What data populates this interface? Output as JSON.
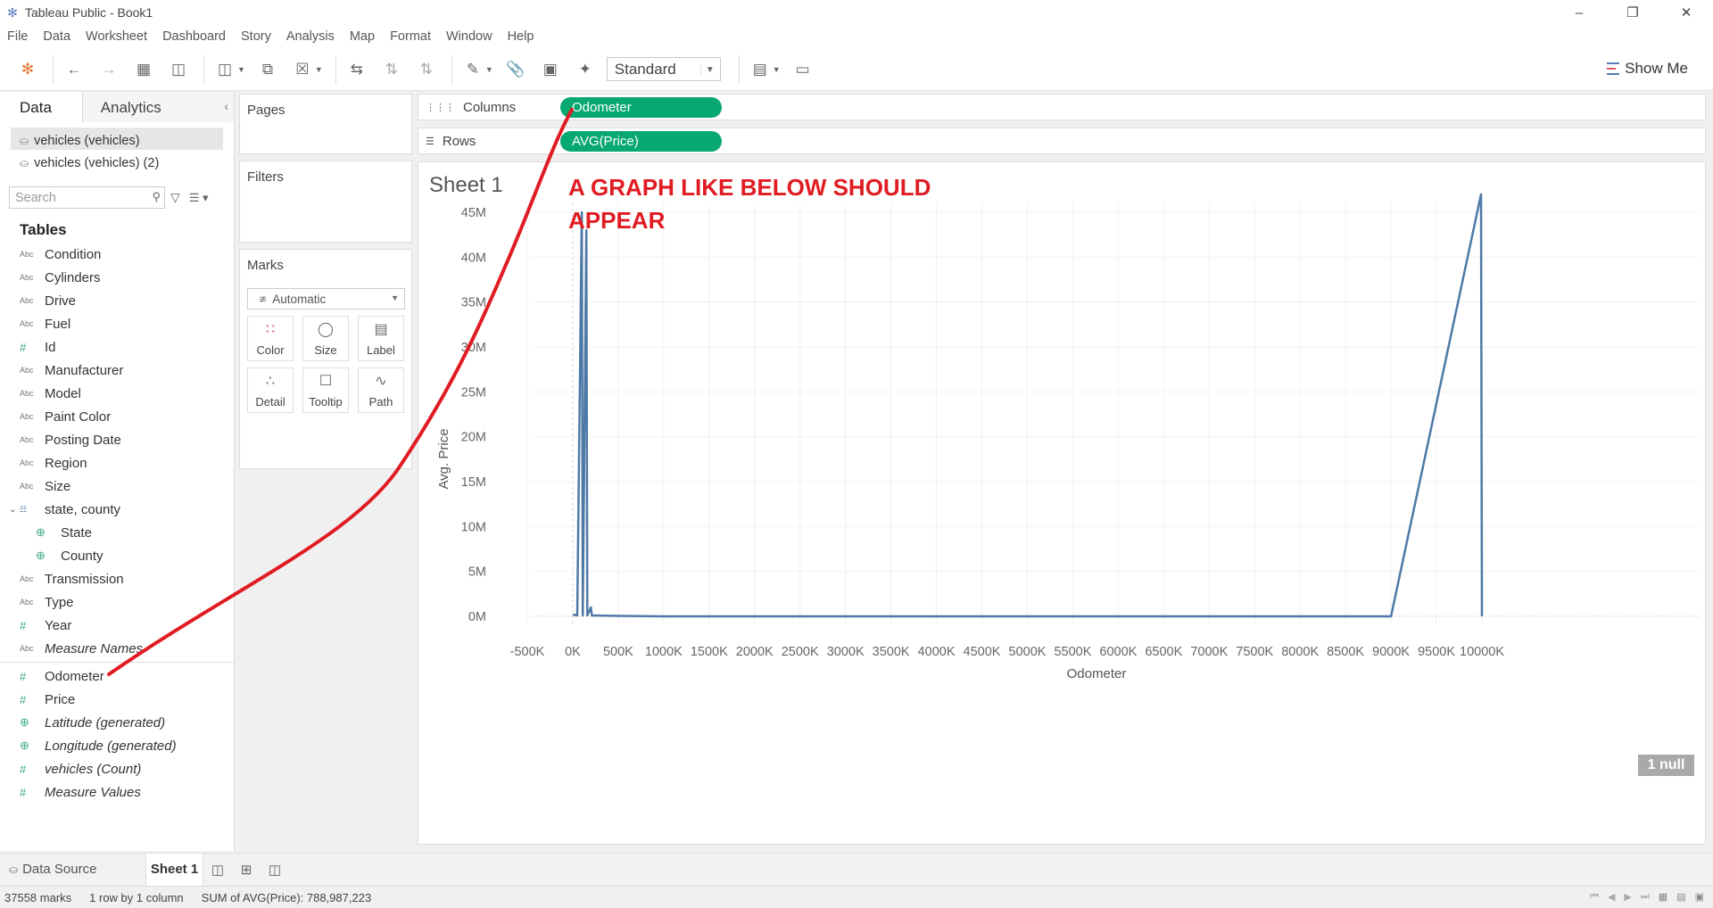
{
  "window": {
    "title": "Tableau Public - Book1"
  },
  "menu": [
    "File",
    "Data",
    "Worksheet",
    "Dashboard",
    "Story",
    "Analysis",
    "Map",
    "Format",
    "Window",
    "Help"
  ],
  "toolbar": {
    "fit": "Standard",
    "show_me": "Show Me"
  },
  "data_pane": {
    "tabs": {
      "data": "Data",
      "analytics": "Analytics"
    },
    "sources": [
      "vehicles (vehicles)",
      "vehicles (vehicles) (2)"
    ],
    "search_placeholder": "Search",
    "tables_heading": "Tables",
    "fields": [
      {
        "type": "Abc",
        "name": "Condition"
      },
      {
        "type": "Abc",
        "name": "Cylinders"
      },
      {
        "type": "Abc",
        "name": "Drive"
      },
      {
        "type": "Abc",
        "name": "Fuel"
      },
      {
        "type": "#",
        "name": "Id"
      },
      {
        "type": "Abc",
        "name": "Manufacturer"
      },
      {
        "type": "Abc",
        "name": "Model"
      },
      {
        "type": "Abc",
        "name": "Paint Color"
      },
      {
        "type": "Abc",
        "name": "Posting Date"
      },
      {
        "type": "Abc",
        "name": "Region"
      },
      {
        "type": "Abc",
        "name": "Size"
      },
      {
        "type": "hier",
        "name": "state, county"
      },
      {
        "type": "geo",
        "name": "State",
        "sub": true
      },
      {
        "type": "geo",
        "name": "County",
        "sub": true
      },
      {
        "type": "Abc",
        "name": "Transmission"
      },
      {
        "type": "Abc",
        "name": "Type"
      },
      {
        "type": "#",
        "name": "Year"
      },
      {
        "type": "Abc",
        "name": "Measure Names",
        "italic": true
      }
    ],
    "measures": [
      {
        "type": "#",
        "name": "Odometer"
      },
      {
        "type": "#",
        "name": "Price"
      },
      {
        "type": "geo",
        "name": "Latitude (generated)",
        "italic": true
      },
      {
        "type": "geo",
        "name": "Longitude (generated)",
        "italic": true
      },
      {
        "type": "#",
        "name": "vehicles (Count)",
        "italic": true
      },
      {
        "type": "#",
        "name": "Measure Values",
        "italic": true
      }
    ]
  },
  "cards": {
    "pages": "Pages",
    "filters": "Filters",
    "marks": "Marks",
    "mark_type": "Automatic",
    "buttons": [
      "Color",
      "Size",
      "Label",
      "Detail",
      "Tooltip",
      "Path"
    ]
  },
  "shelves": {
    "columns_label": "Columns",
    "columns_pill": "Odometer",
    "rows_label": "Rows",
    "rows_pill": "AVG(Price)"
  },
  "view": {
    "sheet_title": "Sheet 1",
    "annotation": "A GRAPH LIKE BELOW SHOULD APPEAR",
    "null_badge": "1 null"
  },
  "chart_data": {
    "type": "line",
    "xlabel": "Odometer",
    "ylabel": "Avg. Price",
    "xlim": [
      -500000,
      10000000
    ],
    "ylim": [
      0,
      45000000
    ],
    "x_ticks": [
      "-500K",
      "0K",
      "500K",
      "1000K",
      "1500K",
      "2000K",
      "2500K",
      "3000K",
      "3500K",
      "4000K",
      "4500K",
      "5000K",
      "5500K",
      "6000K",
      "6500K",
      "7000K",
      "7500K",
      "8000K",
      "8500K",
      "9000K",
      "9500K",
      "10000K"
    ],
    "y_ticks": [
      "0M",
      "5M",
      "10M",
      "15M",
      "20M",
      "25M",
      "30M",
      "35M",
      "40M",
      "45M"
    ],
    "color": "#4e79a7",
    "series": [
      {
        "points": [
          [
            0,
            200000
          ],
          [
            50000,
            100000
          ],
          [
            100000,
            45000000
          ],
          [
            110000,
            100000
          ],
          [
            150000,
            43000000
          ],
          [
            160000,
            100000
          ],
          [
            200000,
            1000000
          ],
          [
            210000,
            100000
          ],
          [
            500000,
            50000
          ],
          [
            1000000,
            0
          ],
          [
            2000000,
            0
          ],
          [
            5000000,
            0
          ],
          [
            8000000,
            0
          ],
          [
            9000000,
            0
          ],
          [
            9990000,
            47000000
          ],
          [
            10000000,
            0
          ]
        ]
      }
    ]
  },
  "tabs": {
    "data_source": "Data Source",
    "sheet": "Sheet 1"
  },
  "status": {
    "marks": "37558 marks",
    "layout": "1 row by 1 column",
    "sum": "SUM of AVG(Price): 788,987,223"
  },
  "colors": {
    "pill": "#07a872",
    "annotation": "#e01b22",
    "line": "#4e79a7"
  }
}
